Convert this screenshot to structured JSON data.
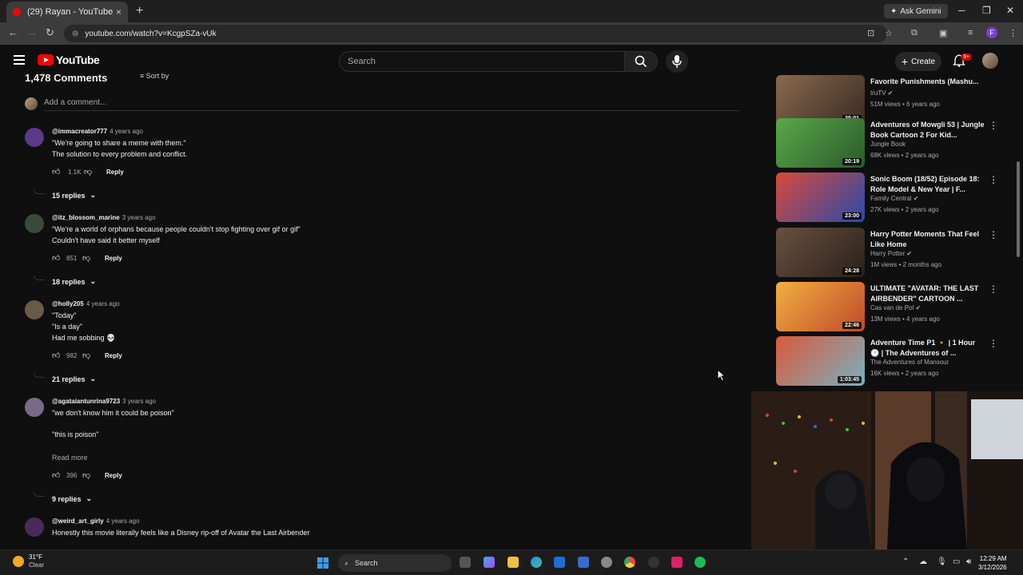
{
  "browser": {
    "tab_title": "(29) Rayan - YouTube",
    "tab_close": "×",
    "new_tab": "+",
    "ask_gemini": "Ask Gemini",
    "url": "youtube.com/watch?v=KcgpSZa-vUk",
    "profile_initial": "F"
  },
  "youtube": {
    "logo_text": "YouTube",
    "search_placeholder": "Search",
    "create_label": "Create",
    "notification_count": "9+"
  },
  "comments": {
    "header": "1,478 Comments",
    "sort_by": "Sort by",
    "add_placeholder": "Add a comment...",
    "items": [
      {
        "user": "@immacreator777",
        "time": "4 years ago",
        "lines": [
          "\"We're going to share a meme with them.\"",
          "The solution to every problem and conflict."
        ],
        "likes": "1.1K",
        "reply": "Reply",
        "replies": "15 replies",
        "avatar_color": "#5a3a8a"
      },
      {
        "user": "@itz_blossom_marine",
        "time": "3 years ago",
        "lines": [
          "\"We're a world of orphans because people couldn't stop fighting over gif or gif\"",
          "Couldn't have said it better myself"
        ],
        "likes": "851",
        "reply": "Reply",
        "replies": "18 replies",
        "avatar_color": "#3a4a3a"
      },
      {
        "user": "@holly205",
        "time": "4 years ago",
        "lines": [
          "\"Today\"",
          "\"Is a day\"",
          "Had me sobbing 💀"
        ],
        "likes": "982",
        "reply": "Reply",
        "replies": "21 replies",
        "avatar_color": "#6a5a4a"
      },
      {
        "user": "@agataiantunrina9723",
        "time": "3 years ago",
        "lines": [
          "\"we don't know him it could be poison\"",
          "\"this is poison\""
        ],
        "read_more": "Read more",
        "likes": "396",
        "reply": "Reply",
        "replies": "9 replies",
        "avatar_color": "#7a6a8a"
      },
      {
        "user": "@weird_art_girly",
        "time": "4 years ago",
        "lines": [
          "Honestly this movie literally feels like a Disney rip-off of Avatar the Last Airbender"
        ],
        "avatar_color": "#4a2a5a"
      }
    ]
  },
  "sidebar": {
    "videos": [
      {
        "title": "Favorite Punishments (Mashu...",
        "channel": "truTV",
        "meta": "51M views • 6 years ago",
        "duration": "35:01",
        "thumb": "#6a5040",
        "verified": true
      },
      {
        "title": "Adventures of Mowgli 53 | Jungle Book Cartoon 2 For Kid...",
        "channel": "Jungle Book",
        "meta": "68K views • 2 years ago",
        "duration": "20:19",
        "thumb": "#3f8a3a",
        "verified": false
      },
      {
        "title": "Sonic Boom (18/52) Episode 18: Role Model & New Year | F...",
        "channel": "Family Central",
        "meta": "27K views • 2 years ago",
        "duration": "23:00",
        "thumb": "#b83a2a",
        "verified": true
      },
      {
        "title": "Harry Potter Moments That Feel Like Home",
        "channel": "Harry Potter",
        "meta": "1M views • 2 months ago",
        "duration": "24:28",
        "thumb": "#4a3a30",
        "verified": true
      },
      {
        "title": "ULTIMATE \"AVATAR: THE LAST AIRBENDER\" CARTOON ...",
        "channel": "Cas van de Pol",
        "meta": "13M views • 4 years ago",
        "duration": "22:46",
        "thumb": "#d88a2a",
        "verified": true
      },
      {
        "title": "Adventure Time P1 🔸 | 1 Hour 🕐 | The Adventures of ...",
        "channel": "The Adventures of Mansour",
        "meta": "16K views • 2 years ago",
        "duration": "1:03:45",
        "thumb": "#c84a3a",
        "verified": false
      }
    ]
  },
  "taskbar": {
    "temp": "31°F",
    "weather": "Clear",
    "search": "Search",
    "time": "12:29 AM",
    "date": "3/12/2026"
  },
  "colors": {
    "background": "#0f0f0f",
    "youtube_red": "#ff0000",
    "text_primary": "#f1f1f1",
    "text_secondary": "#aaaaaa"
  }
}
